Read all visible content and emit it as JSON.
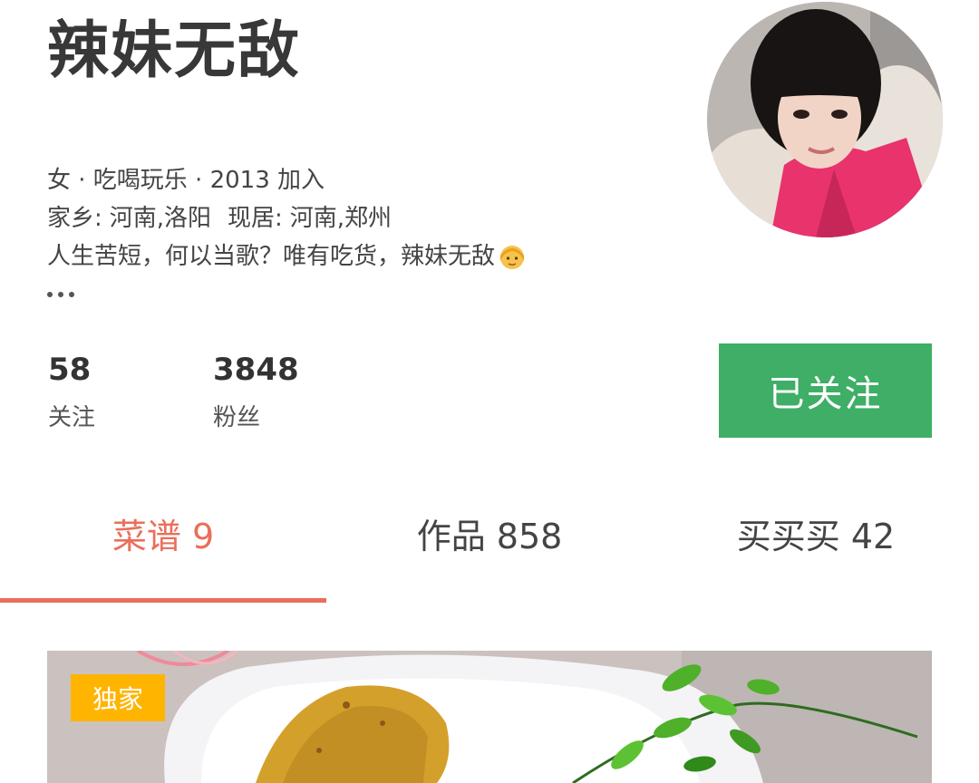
{
  "profile": {
    "name": "辣妹无敌",
    "meta_line": "女 · 吃喝玩乐 · 2013 加入",
    "hometown_label": "家乡:",
    "hometown": "河南,洛阳",
    "residence_label": "现居:",
    "residence": "河南,郑州",
    "bio": "人生苦短，何以当歌？唯有吃货，辣妹无敌"
  },
  "stats": {
    "following_count": "58",
    "following_label": "关注",
    "followers_count": "3848",
    "followers_label": "粉丝"
  },
  "follow_button": {
    "label": "已关注",
    "color": "#3fae66"
  },
  "tabs": [
    {
      "label": "菜谱 9",
      "active": true
    },
    {
      "label": "作品 858",
      "active": false
    },
    {
      "label": "买买买 42",
      "active": false
    }
  ],
  "accent_color": "#ea6f5a",
  "recipe_card": {
    "badge": "独家",
    "badge_color": "#ffb400"
  }
}
